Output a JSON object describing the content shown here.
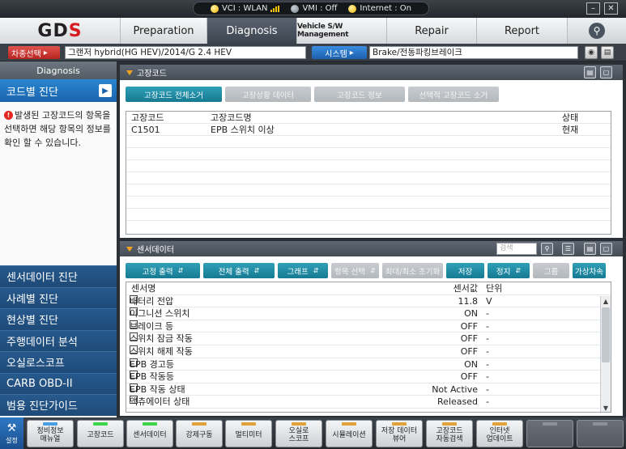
{
  "status_bar": {
    "vci": "VCI : WLAN",
    "vmi": "VMI : Off",
    "internet": "Internet : On"
  },
  "window": {
    "minimize": "–",
    "close": "✕"
  },
  "logo": {
    "text_a": "GD",
    "text_b": "S"
  },
  "nav": {
    "tabs": [
      {
        "label": "Preparation"
      },
      {
        "label": "Diagnosis"
      },
      {
        "label": "Vehicle S/W Management"
      },
      {
        "label": "Repair"
      },
      {
        "label": "Report"
      }
    ],
    "search_icon": "search-icon"
  },
  "vehicle_bar": {
    "select_label": "차종선택",
    "vehicle": "그랜저 hybrid(HG HEV)/2014/G 2.4 HEV",
    "system_label": "시스템",
    "system": "Brake/전동파킹브레이크"
  },
  "sidebar": {
    "header": "Diagnosis",
    "active": "코드별 진단",
    "description": "발생된 고장코드의 항목을 선택하면 해당 항목의 정보를 확인 할 수 있습니다.",
    "items": [
      {
        "label": "센서데이터 진단"
      },
      {
        "label": "사례별 진단"
      },
      {
        "label": "현상별 진단"
      },
      {
        "label": "주행데이터 분석"
      },
      {
        "label": "오실로스코프"
      },
      {
        "label": "CARB OBD-II"
      },
      {
        "label": "범용 진단가이드"
      }
    ]
  },
  "dtc_panel": {
    "title": "고장코드",
    "buttons": [
      {
        "label": "고장코드 전체소거",
        "enabled": true
      },
      {
        "label": "고장상황 데이터",
        "enabled": false
      },
      {
        "label": "고장코드 정보",
        "enabled": false
      },
      {
        "label": "선택적 고장코드 소거",
        "enabled": false
      }
    ],
    "columns": {
      "code": "고장코드",
      "name": "고장코드명",
      "status": "상태"
    },
    "rows": [
      {
        "code": "C1501",
        "name": "EPB 스위치 이상",
        "status": "현재"
      }
    ]
  },
  "sensor_panel": {
    "title": "센서데이터",
    "search_placeholder": "검색",
    "buttons": [
      {
        "label": "고정 출력",
        "enabled": true,
        "dropdown": true
      },
      {
        "label": "전체 출력",
        "enabled": true,
        "dropdown": true
      },
      {
        "label": "그래프",
        "enabled": true,
        "dropdown": true
      },
      {
        "label": "항목 선택",
        "enabled": false,
        "dropdown": true
      },
      {
        "label": "최대/최소 초기화",
        "enabled": false,
        "dropdown": false
      },
      {
        "label": "저장",
        "enabled": true,
        "dropdown": false
      },
      {
        "label": "정지",
        "enabled": true,
        "dropdown": true
      },
      {
        "label": "그룹",
        "enabled": false,
        "dropdown": false
      },
      {
        "label": "가상차속",
        "enabled": true,
        "dropdown": false
      }
    ],
    "columns": {
      "name": "센서명",
      "value": "센서값",
      "unit": "단위"
    },
    "rows": [
      {
        "name": "배터리 전압",
        "value": "11.8",
        "unit": "V"
      },
      {
        "name": "이그니션 스위치",
        "value": "ON",
        "unit": "-"
      },
      {
        "name": "브레이크 등",
        "value": "OFF",
        "unit": "-"
      },
      {
        "name": "스위치 잠금 작동",
        "value": "OFF",
        "unit": "-"
      },
      {
        "name": "스위치 해제 작동",
        "value": "OFF",
        "unit": "-"
      },
      {
        "name": "EPB 경고등",
        "value": "ON",
        "unit": "-"
      },
      {
        "name": "EPB 작동등",
        "value": "OFF",
        "unit": "-"
      },
      {
        "name": "EPB 작동 상태",
        "value": "Not Active",
        "unit": "-"
      },
      {
        "name": "액츄에이터 상태",
        "value": "Released",
        "unit": "-"
      }
    ]
  },
  "bottom_bar": {
    "settings": "설정",
    "buttons": [
      {
        "line1": "정비정보",
        "line2": "매뉴얼",
        "indicator": "blue"
      },
      {
        "line1": "고장코드",
        "line2": "",
        "indicator": "green"
      },
      {
        "line1": "센서데이터",
        "line2": "",
        "indicator": "green"
      },
      {
        "line1": "강제구동",
        "line2": "",
        "indicator": "orange"
      },
      {
        "line1": "멀티미터",
        "line2": "",
        "indicator": "orange"
      },
      {
        "line1": "오실로",
        "line2": "스코프",
        "indicator": "orange"
      },
      {
        "line1": "시뮬레이션",
        "line2": "",
        "indicator": "orange"
      },
      {
        "line1": "저장 데이터",
        "line2": "뷰어",
        "indicator": "orange"
      },
      {
        "line1": "고장코드",
        "line2": "자동검색",
        "indicator": "orange"
      },
      {
        "line1": "인터넷",
        "line2": "업데이트",
        "indicator": "orange"
      }
    ]
  }
}
